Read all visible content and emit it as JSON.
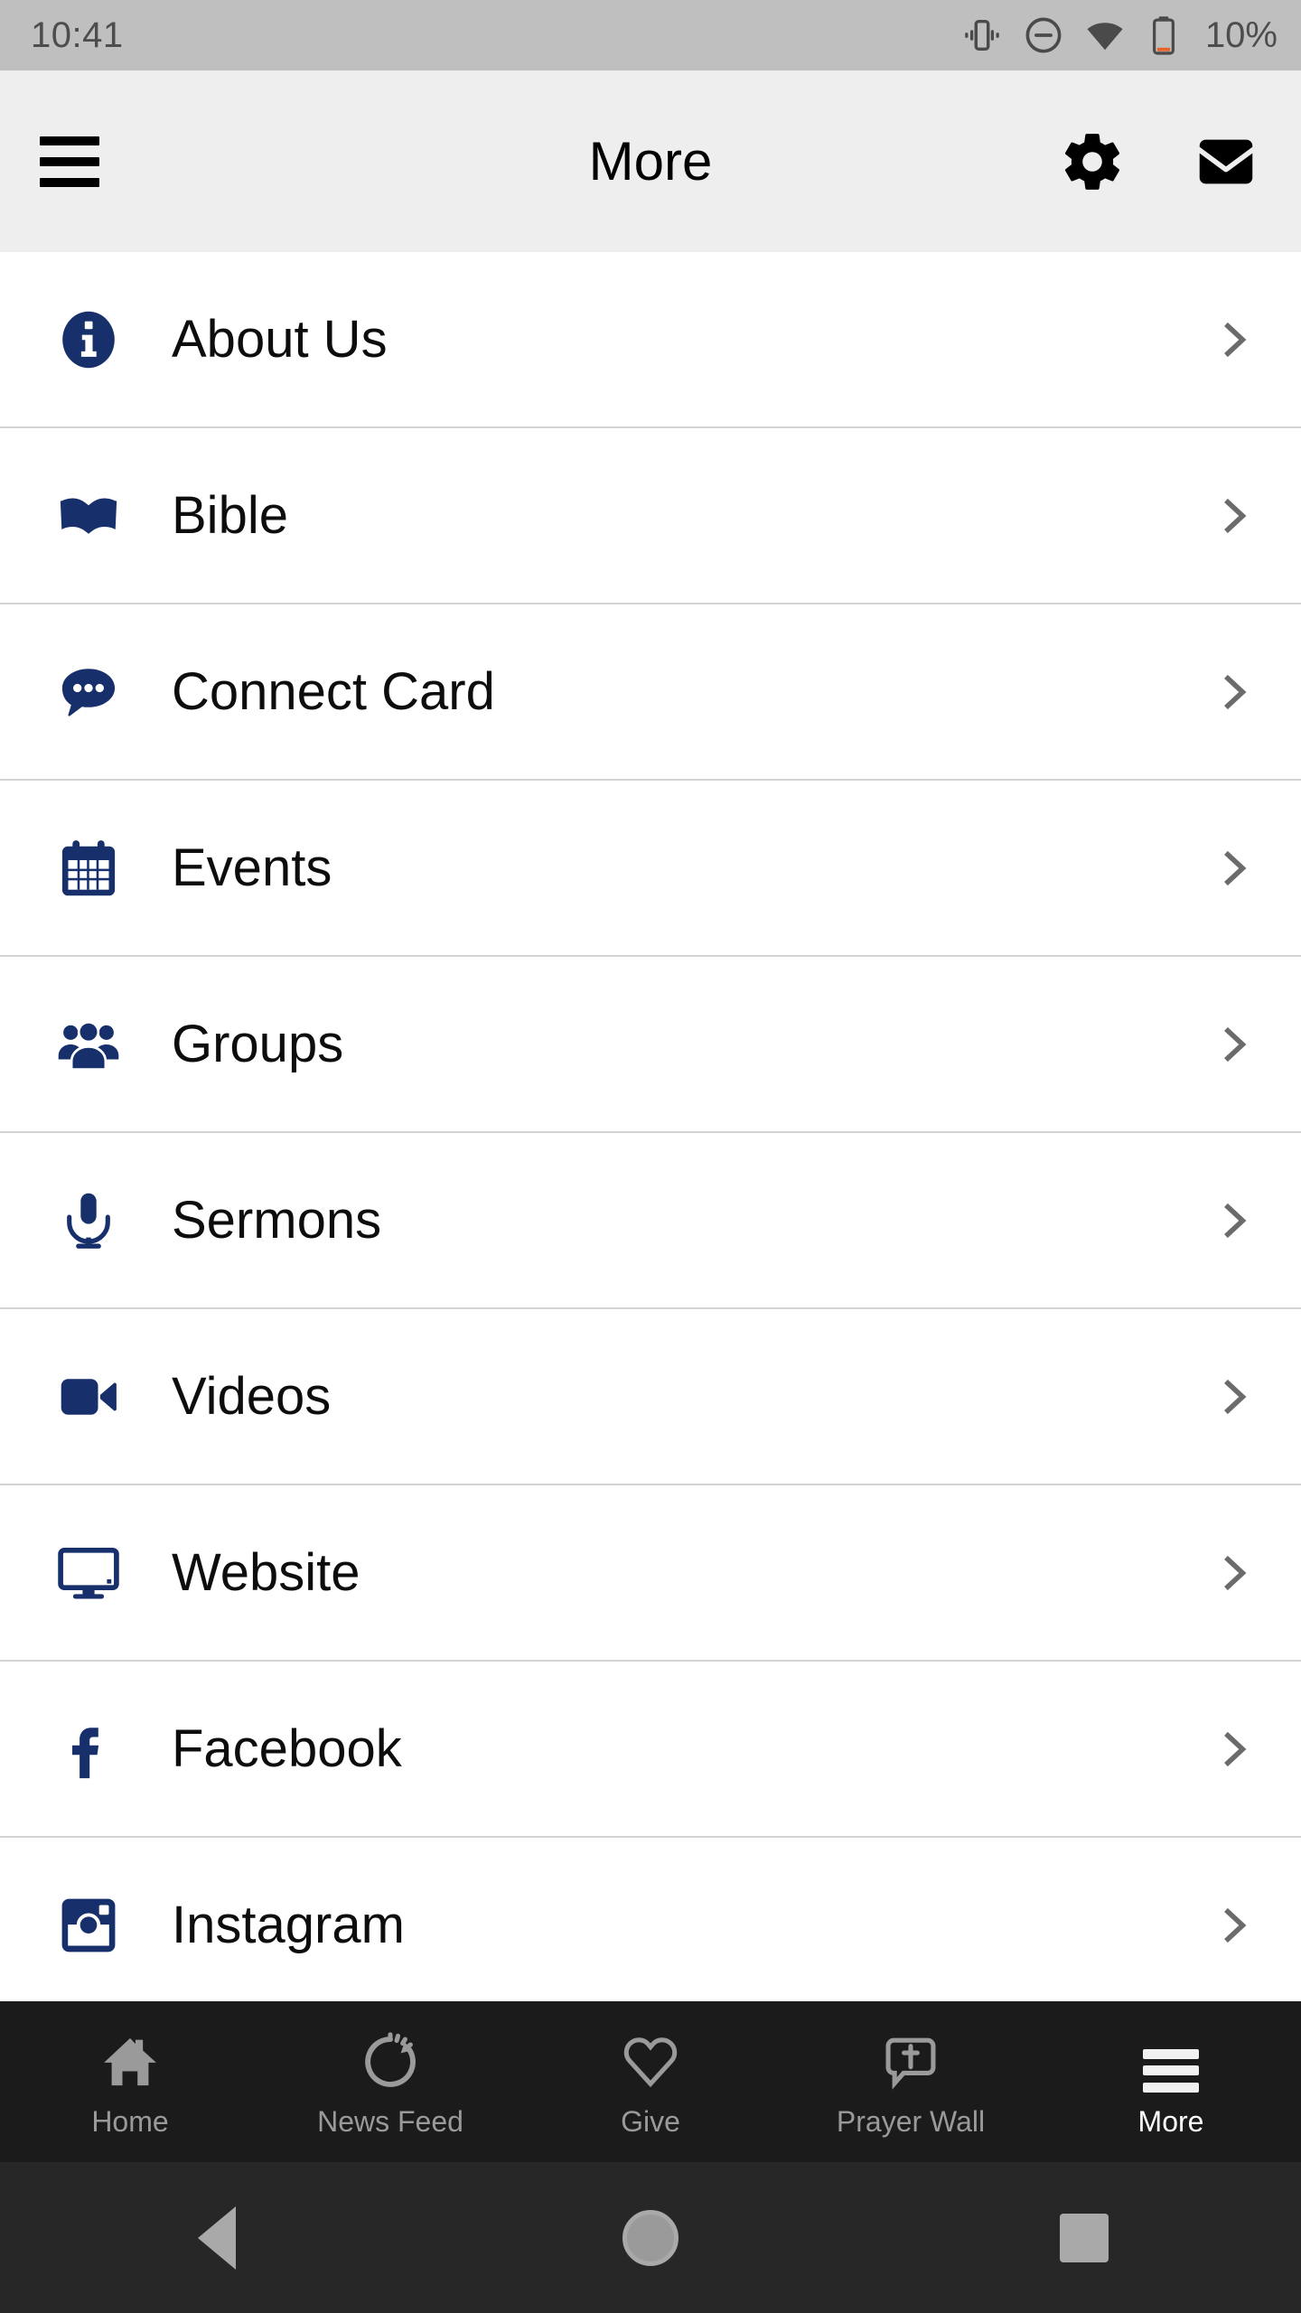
{
  "status_bar": {
    "time": "10:41",
    "battery_percent": "10%",
    "icons": [
      "vibrate-icon",
      "do-not-disturb-icon",
      "wifi-icon",
      "battery-icon"
    ],
    "battery_fill_color": "#e8622a",
    "background_color": "#bfbfbf"
  },
  "header": {
    "title": "More",
    "menu_icon": "hamburger-menu-icon",
    "actions": [
      {
        "name": "settings-button",
        "icon": "gear-icon"
      },
      {
        "name": "messages-button",
        "icon": "envelope-icon"
      }
    ],
    "background_color": "#eeeeee"
  },
  "theme": {
    "icon_navy": "#17306b",
    "chevron_gray": "#6b6b6b",
    "divider": "#d4d4d4",
    "tabbar_bg": "#1b1b1b",
    "navbar_bg": "#272727"
  },
  "list": {
    "items": [
      {
        "label": "About Us",
        "icon": "info-circle-icon"
      },
      {
        "label": "Bible",
        "icon": "open-book-icon"
      },
      {
        "label": "Connect Card",
        "icon": "speech-bubble-dots-icon"
      },
      {
        "label": "Events",
        "icon": "calendar-icon"
      },
      {
        "label": "Groups",
        "icon": "people-group-icon"
      },
      {
        "label": "Sermons",
        "icon": "microphone-icon"
      },
      {
        "label": "Videos",
        "icon": "video-camera-icon"
      },
      {
        "label": "Website",
        "icon": "desktop-monitor-icon"
      },
      {
        "label": "Facebook",
        "icon": "facebook-f-icon"
      },
      {
        "label": "Instagram",
        "icon": "instagram-camera-icon"
      }
    ],
    "chevron_icon": "chevron-right-icon"
  },
  "tab_bar": {
    "tabs": [
      {
        "label": "Home",
        "icon": "house-icon",
        "active": false
      },
      {
        "label": "News Feed",
        "icon": "refresh-spinner-icon",
        "active": false
      },
      {
        "label": "Give",
        "icon": "heart-outline-icon",
        "active": false
      },
      {
        "label": "Prayer Wall",
        "icon": "speech-bubble-cross-icon",
        "active": false
      },
      {
        "label": "More",
        "icon": "hamburger-menu-icon",
        "active": true
      }
    ]
  },
  "nav_bar": {
    "buttons": [
      {
        "name": "back-button",
        "icon": "triangle-back-icon"
      },
      {
        "name": "home-button",
        "icon": "circle-home-icon"
      },
      {
        "name": "recent-apps-button",
        "icon": "square-recents-icon"
      }
    ]
  }
}
